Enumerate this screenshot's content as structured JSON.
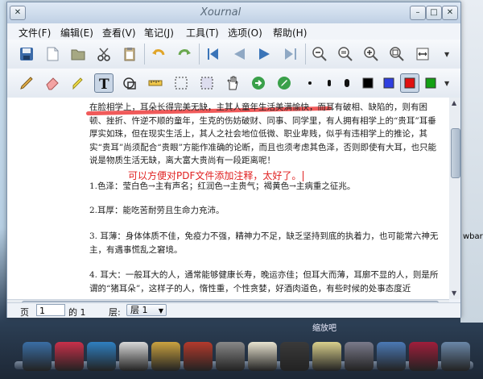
{
  "window": {
    "title": "Xournal"
  },
  "menu": {
    "items": [
      {
        "id": "file",
        "label": "文件(F)"
      },
      {
        "id": "edit",
        "label": "编辑(E)"
      },
      {
        "id": "view",
        "label": "查看(V)"
      },
      {
        "id": "journal",
        "label": "笔记(J)"
      },
      {
        "id": "tools",
        "label": "工具(T)"
      },
      {
        "id": "options",
        "label": "选项(O)"
      },
      {
        "id": "help",
        "label": "帮助(H)"
      }
    ]
  },
  "toolbar1": [
    "save-icon",
    "new-page-icon",
    "open-folder-icon",
    "cut-icon",
    "paste-icon",
    "undo-icon",
    "redo-icon",
    "first-page-icon",
    "previous-page-icon",
    "next-page-icon",
    "last-page-icon",
    "zoom-out-icon",
    "zoom-reset-icon",
    "zoom-in-icon",
    "zoom-fullscreen-icon"
  ],
  "toolbar2": [
    "pen-icon",
    "eraser-icon",
    "highlighter-icon",
    "text-tool-icon",
    "shape-recognizer-icon",
    "ruler-icon",
    "select-region-icon",
    "select-rectangle-icon",
    "hand-icon",
    "default-tool-icon",
    "default-pen-icon",
    "thin-dot-icon",
    "medium-dot-icon",
    "thick-dot-icon"
  ],
  "colors": {
    "black": "#000000",
    "blue": "#2f3fe0",
    "red": "#e01010",
    "green": "#13a013",
    "annotation": "#e02020",
    "highlight": "#f05a5a"
  },
  "document": {
    "paragraphs": [
      "在脸相学上，耳朵长得完美无缺，主其人童年生活美满愉快，而耳有破相、缺陷的，则有困顿、挫折、忤逆不顺的童年，生克的伤妨破财、同事、同学里，有人拥有相学上的“贵耳”耳垂厚实如珠，但在现实生活上，其人之社会地位低微、职业卑贱，似乎有违相学上的推论，其实“贵耳”尚须配合“贵眼”方能作准确的论断，而且也须考虑其色泽，否则即使有大耳，也只能说是物质生活无缺，离大富大贵尚有一段距离呢！",
      "1.色泽：莹白色→主有声名；红润色→主贵气；褐黄色→主病重之征兆。",
      "2.耳厚：能吃苦耐劳且生命力充沛。",
      "3. 耳薄：身体体质不佳，免疫力不强，精神力不足，缺乏坚持到底的执着力，也可能常六神无主，有遇事慌乱之窘境。",
      "4. 耳大：一般耳大的人，通常能够健康长寿，晚运亦佳；但耳大而薄，耳廓不显的人，则是所谓的“猪耳朵”，这样子的人，惰性重，个性贪婪，好酒肉道色，有些时候的处事态度近"
    ],
    "annotation": "可以方便对PDF文件添加注释，太好了。"
  },
  "statusbar": {
    "page_label": "页",
    "page_value": "1",
    "of_label": "的 1",
    "layer_label": "层:",
    "layer_value": "层 1"
  },
  "desktop": {
    "side_text": "wbar",
    "dock_caption": "缩放吧"
  },
  "dock": [
    {
      "icon": "folder-icon",
      "color": "#3a6ea5"
    },
    {
      "icon": "app-red-icon",
      "color": "#c9304a"
    },
    {
      "icon": "globe-icon",
      "color": "#2f7fc0"
    },
    {
      "icon": "user-icon",
      "color": "#d8d8d8"
    },
    {
      "icon": "music-icon",
      "color": "#caa240"
    },
    {
      "icon": "tools-icon",
      "color": "#b43a2c"
    },
    {
      "icon": "settings-icon",
      "color": "#888888"
    },
    {
      "icon": "document-icon",
      "color": "#e8e3d0"
    },
    {
      "icon": "terminal-icon",
      "color": "#3a3a3a"
    },
    {
      "icon": "notepad-icon",
      "color": "#d9d08c"
    },
    {
      "icon": "drive-icon",
      "color": "#7a7a8a"
    },
    {
      "icon": "window-icon",
      "color": "#4b79b5"
    },
    {
      "icon": "update-icon",
      "color": "#a01e3b"
    },
    {
      "icon": "network-icon",
      "color": "#6a87a8"
    }
  ]
}
